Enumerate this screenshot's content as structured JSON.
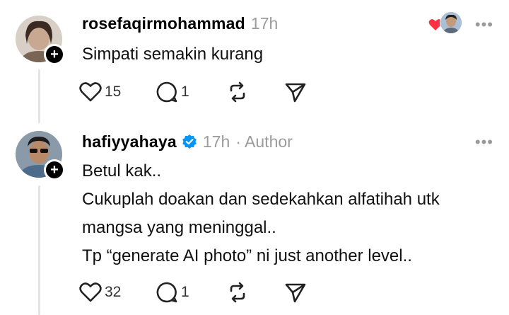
{
  "posts": [
    {
      "username": "rosefaqirmohammad",
      "time": "17h",
      "author_tag": "",
      "lines": [
        "Simpati semakin kurang"
      ],
      "likes": "15",
      "replies": "1",
      "more": "•••"
    },
    {
      "username": "hafiyyahaya",
      "time": "17h",
      "author_tag": "· Author",
      "lines": [
        "Betul kak..",
        "Cukuplah doakan dan sedekahkan alfatihah utk",
        "mangsa yang meninggal..",
        "Tp “generate AI photo” ni just another level.."
      ],
      "likes": "32",
      "replies": "1",
      "more": "•••"
    }
  ],
  "follow_symbol": "+",
  "colors": {
    "heart": "#ff3040",
    "verified": "#0095f6",
    "muted": "#9b9b9b"
  },
  "icons": [
    "heart-icon",
    "comment-icon",
    "repost-icon",
    "share-icon",
    "verified-icon",
    "more-icon"
  ]
}
